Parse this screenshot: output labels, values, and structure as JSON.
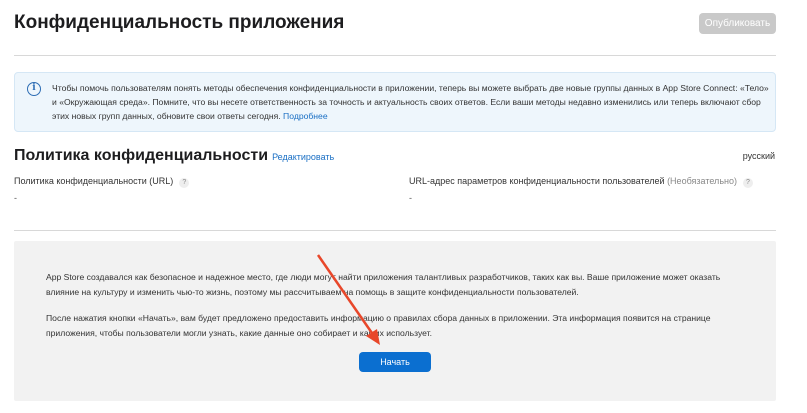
{
  "header": {
    "title": "Конфиденциальность приложения",
    "publish_label": "Опубликовать"
  },
  "info": {
    "text": "Чтобы помочь пользователям понять методы обеспечения конфиденциальности в приложении, теперь вы можете выбрать две новые группы данных в App Store Connect: «Тело» и «Окружающая среда». Помните, что вы несете ответственность за точность и актуальность своих ответов. Если ваши методы недавно изменились или теперь включают сбор этих новых групп данных, обновите свои ответы сегодня.",
    "link": "Подробнее"
  },
  "policy": {
    "title": "Политика конфиденциальности",
    "edit_label": "Редактировать",
    "language": "русский",
    "url_label": "Политика конфиденциальности (URL)",
    "url_value": "-",
    "choices_label": "URL-адрес параметров конфиденциальности пользователей",
    "optional": "(Необязательно)",
    "choices_value": "-",
    "help": "?"
  },
  "intro": {
    "p1": "App Store создавался как безопасное и надежное место, где люди могут найти приложения талантливых разработчиков, таких как вы. Ваше приложение может оказать влияние на культуру и изменить чью-то жизнь, поэтому мы рассчитываем на помощь в защите конфиденциальности пользователей.",
    "p2": "После нажатия кнопки «Начать», вам будет предложено предоставить информацию о правилах сбора данных в приложении. Эта информация появится на странице приложения, чтобы пользователи могли узнать, какие данные оно собирает и как их использует.",
    "start_label": "Начать"
  },
  "colors": {
    "accent": "#0b6fd0",
    "arrow": "#e8472a"
  }
}
